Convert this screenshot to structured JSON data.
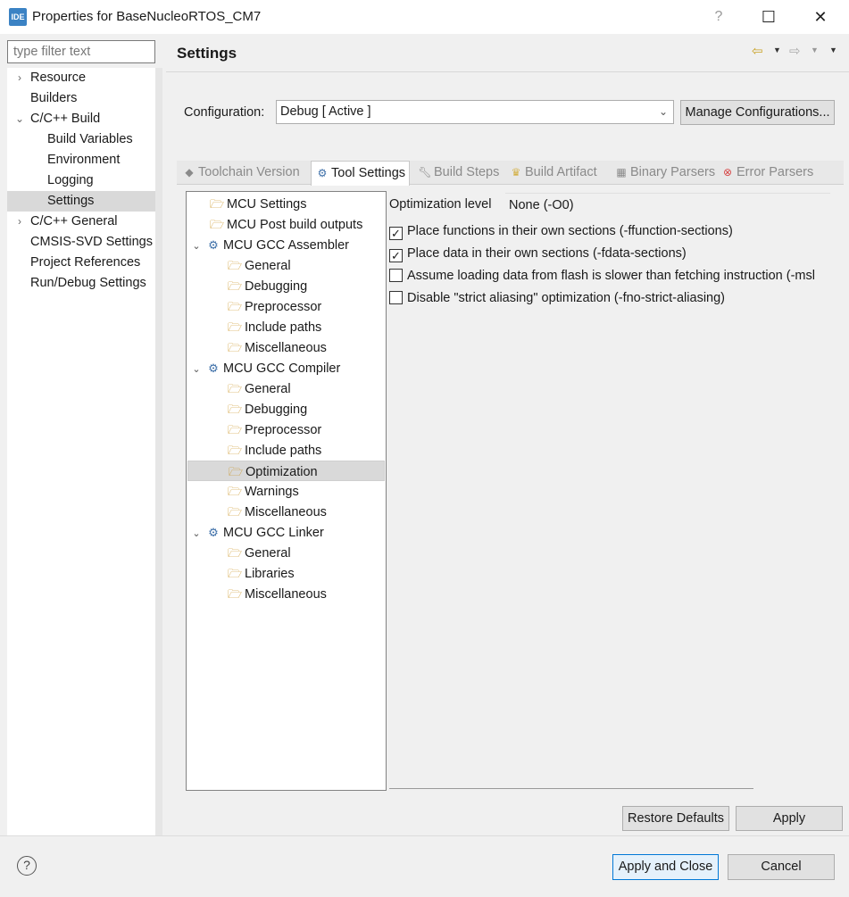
{
  "window": {
    "app_icon": "IDE",
    "title": "Properties for BaseNucleoRTOS_CM7",
    "help_glyph": "?",
    "maximize_glyph": "☐",
    "close_glyph": "✕"
  },
  "filter": {
    "placeholder": "type filter text"
  },
  "left_nav": {
    "items": [
      {
        "label": "Resource",
        "chevron": "›"
      },
      {
        "label": "Builders"
      },
      {
        "label": "C/C++ Build",
        "chevron": "⌄"
      },
      {
        "label": "Build Variables"
      },
      {
        "label": "Environment"
      },
      {
        "label": "Logging"
      },
      {
        "label": "Settings"
      },
      {
        "label": "C/C++ General",
        "chevron": "›"
      },
      {
        "label": "CMSIS-SVD Settings"
      },
      {
        "label": "Project References"
      },
      {
        "label": "Run/Debug Settings"
      }
    ]
  },
  "header": {
    "title": "Settings"
  },
  "configuration": {
    "label": "Configuration:",
    "value": "Debug  [ Active ]",
    "manage_label": "Manage Configurations..."
  },
  "tabs": [
    {
      "label": "Toolchain  Version"
    },
    {
      "label": "Tool Settings"
    },
    {
      "label": "Build Steps"
    },
    {
      "label": "Build Artifact"
    },
    {
      "label": "Binary Parsers"
    },
    {
      "label": "Error Parsers"
    }
  ],
  "tool_tree": [
    {
      "label": "MCU Settings"
    },
    {
      "label": "MCU Post build outputs"
    },
    {
      "label": "MCU GCC Assembler"
    },
    {
      "label": "General"
    },
    {
      "label": "Debugging"
    },
    {
      "label": "Preprocessor"
    },
    {
      "label": "Include paths"
    },
    {
      "label": "Miscellaneous"
    },
    {
      "label": "MCU GCC Compiler"
    },
    {
      "label": "General"
    },
    {
      "label": "Debugging"
    },
    {
      "label": "Preprocessor"
    },
    {
      "label": "Include paths"
    },
    {
      "label": "Optimization"
    },
    {
      "label": "Warnings"
    },
    {
      "label": "Miscellaneous"
    },
    {
      "label": "MCU GCC Linker"
    },
    {
      "label": "General"
    },
    {
      "label": "Libraries"
    },
    {
      "label": "Miscellaneous"
    }
  ],
  "optimization": {
    "level_label": "Optimization level",
    "level_value": "None (-O0)",
    "options": [
      {
        "label": "Place functions in their own sections (-ffunction-sections)",
        "checked": true
      },
      {
        "label": "Place data in their own sections (-fdata-sections)",
        "checked": true
      },
      {
        "label": "Assume loading data from flash is slower than fetching instruction (-msl",
        "checked": false
      },
      {
        "label": "Disable \"strict aliasing\" optimization (-fno-strict-aliasing)",
        "checked": false
      }
    ]
  },
  "buttons": {
    "restore_defaults": "Restore Defaults",
    "apply": "Apply",
    "apply_and_close": "Apply and Close",
    "cancel": "Cancel"
  }
}
